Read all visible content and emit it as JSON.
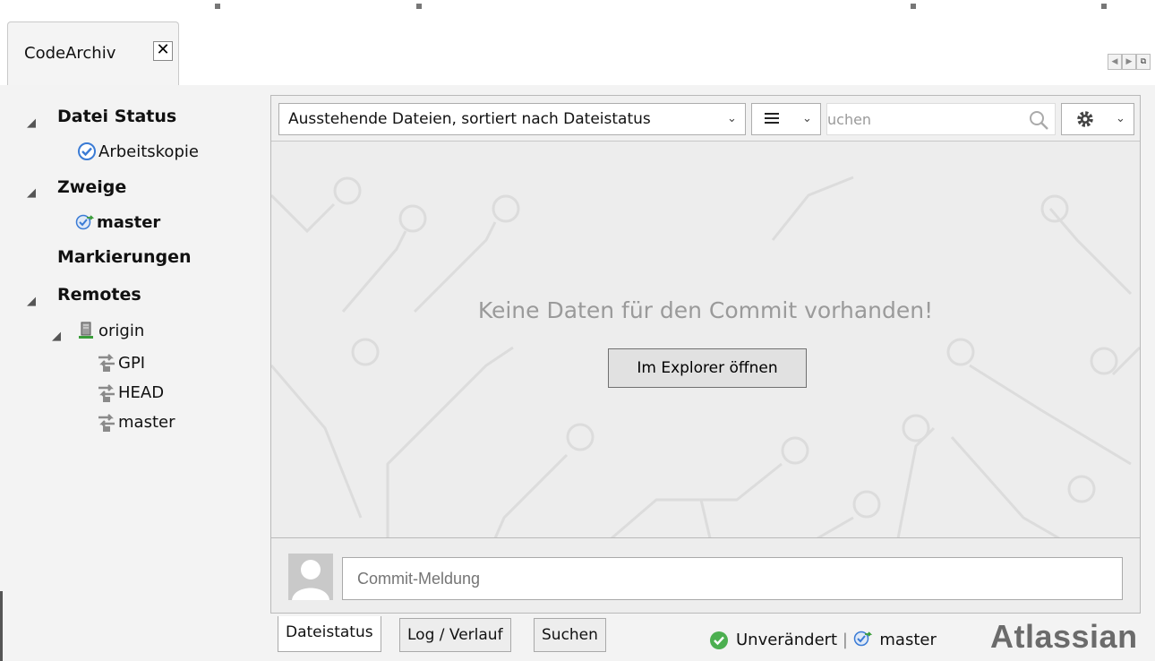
{
  "window": {
    "tab_title": "CodeArchiv",
    "close_glyph": "✕"
  },
  "sidebar": {
    "sections": [
      {
        "label": "Datei Status",
        "items": [
          {
            "label": "Arbeitskopie",
            "icon": "check-circle-icon"
          }
        ]
      },
      {
        "label": "Zweige",
        "items": [
          {
            "label": "master",
            "icon": "branch-icon"
          }
        ]
      },
      {
        "label": "Markierungen"
      },
      {
        "label": "Remotes",
        "children": [
          {
            "label": "origin",
            "icon": "server-icon",
            "items": [
              "GPI",
              "HEAD",
              "master"
            ]
          }
        ]
      }
    ]
  },
  "toolbar": {
    "filter_label": "Ausstehende Dateien, sortiert nach Dateistatus",
    "view_icon": "list-icon",
    "search_placeholder": "uchen",
    "settings_icon": "gear-icon"
  },
  "content": {
    "empty_message": "Keine Daten für den Commit vorhanden!",
    "explorer_button": "Im Explorer öffnen"
  },
  "commit": {
    "placeholder": "Commit-Meldung"
  },
  "bottom_tabs": [
    "Dateistatus",
    "Log / Verlauf",
    "Suchen"
  ],
  "status": {
    "state": "Unverändert",
    "separator": "|",
    "branch": "master"
  },
  "brand": "Atlassian",
  "colors": {
    "accent_blue": "#3a7bd5",
    "ok_green": "#4caf50",
    "branch_green": "#3a9d3a"
  }
}
